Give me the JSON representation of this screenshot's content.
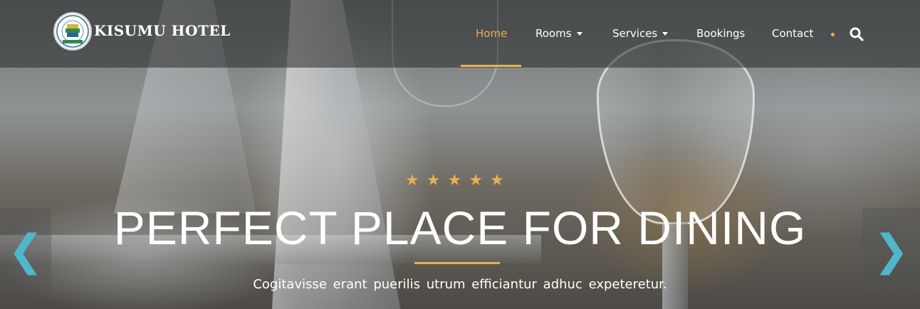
{
  "brand": {
    "name": "KISUMU HOTEL"
  },
  "nav": {
    "items": [
      {
        "label": "Home",
        "active": true,
        "has_dropdown": false
      },
      {
        "label": "Rooms",
        "active": false,
        "has_dropdown": true
      },
      {
        "label": "Services",
        "active": false,
        "has_dropdown": true
      },
      {
        "label": "Bookings",
        "active": false,
        "has_dropdown": false
      },
      {
        "label": "Contact",
        "active": false,
        "has_dropdown": false
      }
    ],
    "search_icon": "search-icon"
  },
  "hero": {
    "star_count": 5,
    "headline": "PERFECT PLACE FOR DINING",
    "subtitle": "Cogitavisse erant puerilis utrum efficiantur adhuc expeteretur.",
    "prev_glyph": "❮",
    "next_glyph": "❯"
  },
  "colors": {
    "accent": "#e8b14f",
    "arrow": "#4fb7c9"
  }
}
